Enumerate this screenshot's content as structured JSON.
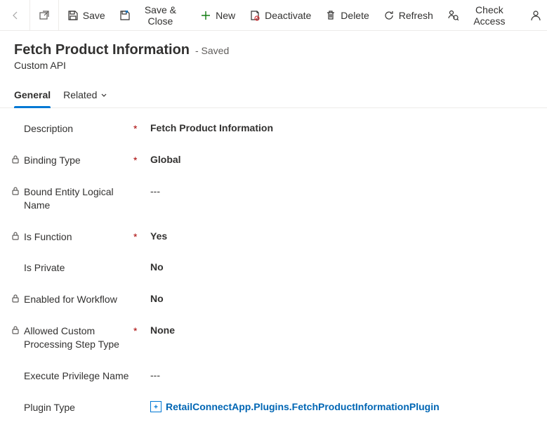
{
  "toolbar": {
    "save": "Save",
    "save_close": "Save & Close",
    "new": "New",
    "deactivate": "Deactivate",
    "delete": "Delete",
    "refresh": "Refresh",
    "check_access": "Check Access"
  },
  "header": {
    "title": "Fetch Product Information",
    "status": "- Saved",
    "subtitle": "Custom API"
  },
  "tabs": {
    "general": "General",
    "related": "Related"
  },
  "form": {
    "description": {
      "label": "Description",
      "value": "Fetch Product Information",
      "required": true,
      "locked": false
    },
    "binding_type": {
      "label": "Binding Type",
      "value": "Global",
      "required": true,
      "locked": true
    },
    "bound_entity": {
      "label": "Bound Entity Logical Name",
      "value": "---",
      "required": false,
      "locked": true
    },
    "is_function": {
      "label": "Is Function",
      "value": "Yes",
      "required": true,
      "locked": true
    },
    "is_private": {
      "label": "Is Private",
      "value": "No",
      "required": false,
      "locked": false
    },
    "enabled_workflow": {
      "label": "Enabled for Workflow",
      "value": "No",
      "required": false,
      "locked": true
    },
    "allowed_custom": {
      "label": "Allowed Custom Processing Step Type",
      "value": "None",
      "required": true,
      "locked": true
    },
    "execute_privilege": {
      "label": "Execute Privilege Name",
      "value": "---",
      "required": false,
      "locked": false
    },
    "plugin_type": {
      "label": "Plugin Type",
      "value": "RetailConnectApp.Plugins.FetchProductInformationPlugin",
      "required": false,
      "locked": false
    }
  }
}
